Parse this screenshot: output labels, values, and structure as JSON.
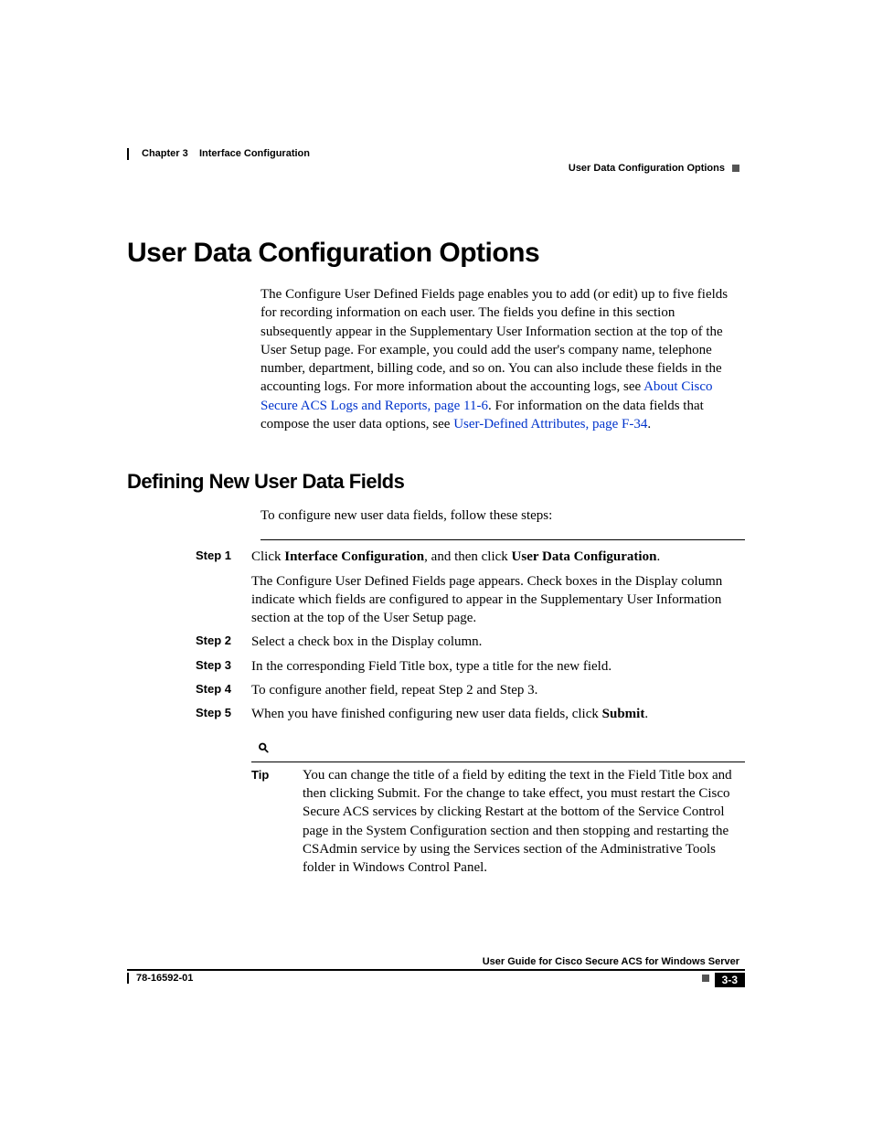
{
  "header": {
    "chapter": "Chapter 3",
    "chapter_title": "Interface Configuration",
    "section": "User Data Configuration Options"
  },
  "headings": {
    "h1": "User Data Configuration Options",
    "h2": "Defining New User Data Fields"
  },
  "intro": {
    "pre_link1": "The Configure User Defined Fields page enables you to add (or edit) up to five fields for recording information on each user. The fields you define in this section subsequently appear in the Supplementary User Information section at the top of the User Setup page. For example, you could add the user's company name, telephone number, department, billing code, and so on. You can also include these fields in the accounting logs. For more information about the accounting logs, see ",
    "link1": "About Cisco Secure ACS Logs and Reports, page 11-6",
    "mid": ". For information on the data fields that compose the user data options, see ",
    "link2": "User-Defined Attributes, page F-34",
    "post": "."
  },
  "intro2": "To configure new user data fields, follow these steps:",
  "steps": {
    "s1": {
      "label": "Step 1",
      "pre": "Click ",
      "b1": "Interface Configuration",
      "mid": ", and then click ",
      "b2": "User Data Configuration",
      "post": ".",
      "note": "The Configure User Defined Fields page appears. Check boxes in the Display column indicate which fields are configured to appear in the Supplementary User Information section at the top of the User Setup page."
    },
    "s2": {
      "label": "Step 2",
      "text": "Select a check box in the Display column."
    },
    "s3": {
      "label": "Step 3",
      "text": "In the corresponding Field Title box, type a title for the new field."
    },
    "s4": {
      "label": "Step 4",
      "text": "To configure another field, repeat Step 2 and Step 3."
    },
    "s5": {
      "label": "Step 5",
      "pre": "When you have finished configuring new user data fields, click ",
      "b1": "Submit",
      "post": "."
    }
  },
  "tip": {
    "label": "Tip",
    "text": "You can change the title of a field by editing the text in the Field Title box and then clicking Submit. For the change to take effect, you must restart the Cisco Secure ACS services by clicking Restart at the bottom of the Service Control page in the System Configuration section and then stopping and restarting the CSAdmin service by using the Services section of the Administrative Tools folder in Windows Control Panel."
  },
  "footer": {
    "guide": "User Guide for Cisco Secure ACS for Windows Server",
    "docnum": "78-16592-01",
    "pagenum": "3-3"
  }
}
